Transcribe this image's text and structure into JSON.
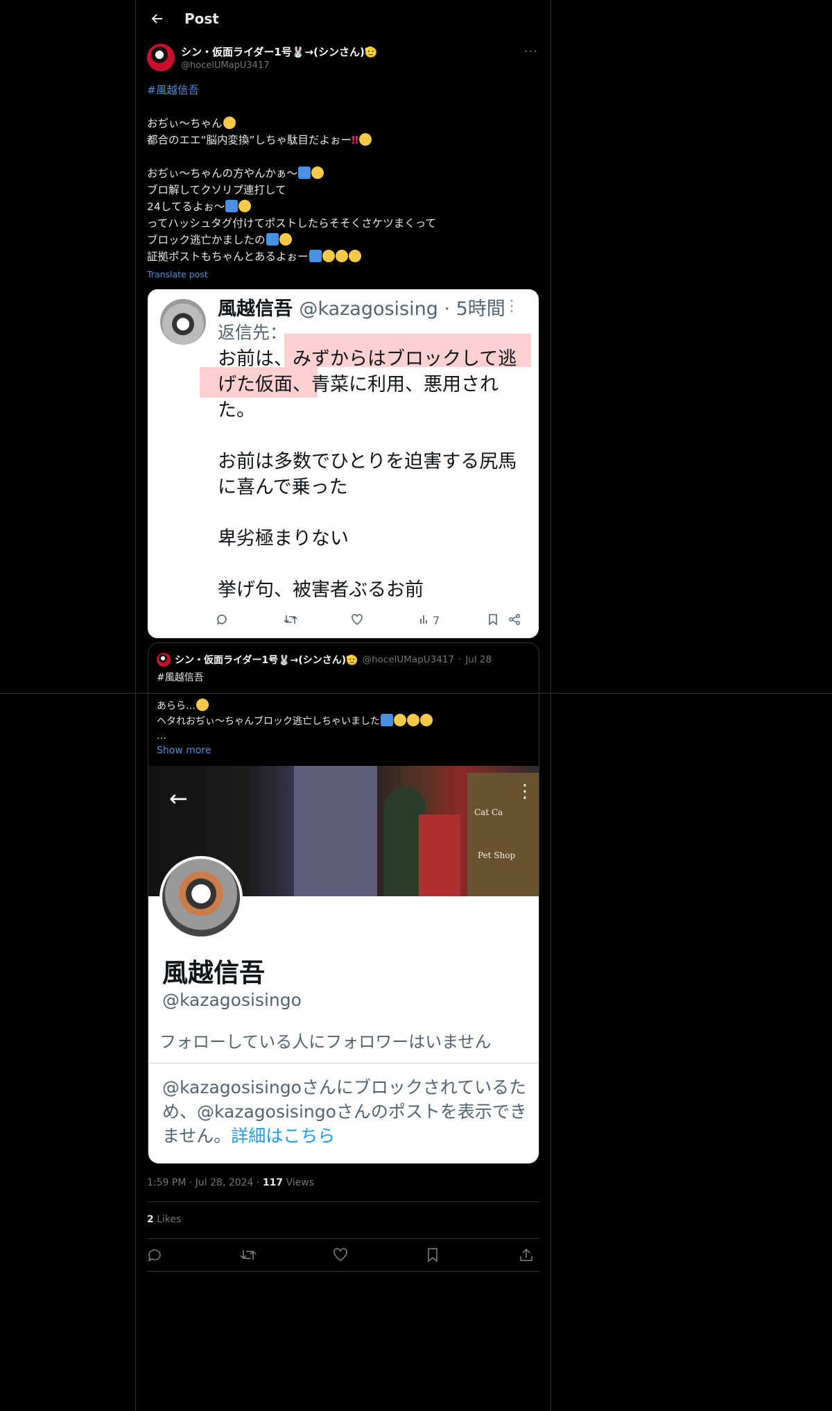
{
  "header": {
    "title": "Post"
  },
  "post": {
    "author_name": "シン・仮面ライダー1号🐰→(シンさん)🫡",
    "author_handle": "@hocelUMapU3417",
    "hashtag": "#風越信吾",
    "lines": [
      "おぢぃ〜ちゃん",
      "都合のエエ“脳内変換”しちゃ駄目だよぉー",
      "おぢぃ〜ちゃんの方やんかぁ〜",
      "ブロ解してクソリプ連打して",
      "24してるよぉ〜",
      "ってハッシュタグ付けてポストしたらそそくさケツまくって",
      "ブロック逃亡かましたの",
      "証拠ポストもちゃんとあるよぉー"
    ],
    "translate": "Translate post"
  },
  "media1": {
    "name": "風越信吾",
    "handle_time": "@kazagosising · 5時間",
    "reply_label": "返信先：",
    "text_lines": [
      "お前は、みずからはブロックして逃",
      "げた仮面、青菜に利用、悪用され",
      "た。",
      "",
      "お前は多数でひとりを迫害する尻馬",
      "に喜んで乗った",
      "",
      "卑劣極まりない",
      "",
      "挙げ句、被害者ぶるお前"
    ],
    "views": "7"
  },
  "quote": {
    "author_name": "シン・仮面ライダー1号🐰→(シンさん)🫡",
    "author_handle": "@hocelUMapU3417",
    "date": "Jul 28",
    "hashtag": "#風越信吾",
    "line1": "あらら…",
    "line2": "ヘタれおぢぃ〜ちゃんブロック逃亡しちゃいました",
    "ellipsis": "…",
    "show_more": "Show more"
  },
  "profile_shot": {
    "sign1": "Cat Ca",
    "sign2": "Pet Shop",
    "name": "風越信吾",
    "handle": "@kazagosisingo",
    "follow_note": "フォローしている人にフォロワーはいません",
    "blocked_text": "@kazagosisingoさんにブロックされているため、@kazagosisingoさんのポストを表示できません。",
    "blocked_link": "詳細はこちら"
  },
  "meta": {
    "time": "1:59 PM",
    "date": "Jul 28, 2024",
    "views_count": "117",
    "views_label": "Views",
    "likes_count": "2",
    "likes_label": "Likes"
  },
  "colors": {
    "accent": "#1d9bf0",
    "link": "#4a90e2",
    "bg": "#000000",
    "border": "#2f3336"
  }
}
